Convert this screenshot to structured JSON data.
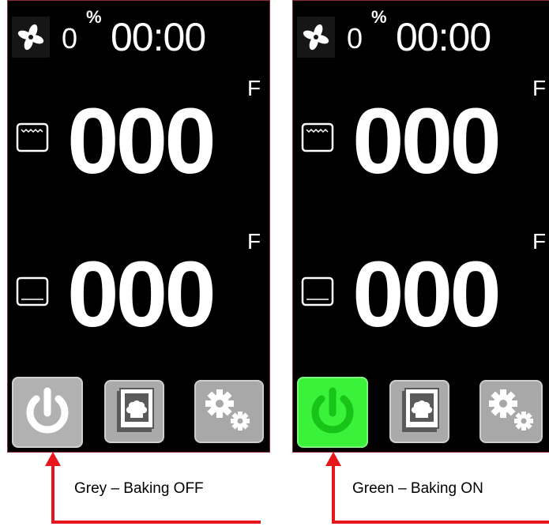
{
  "panels": [
    {
      "fan_icon": "fan-icon",
      "humidity_value": "0",
      "humidity_unit": "%",
      "clock": "00:00",
      "top_zone": {
        "icon": "oven-top-heat-icon",
        "temperature": "000",
        "unit": "F"
      },
      "bottom_zone": {
        "icon": "oven-bottom-heat-icon",
        "temperature": "000",
        "unit": "F"
      },
      "buttons": [
        {
          "name": "power",
          "icon": "power-icon",
          "state": "off",
          "color": "#b1b1b1"
        },
        {
          "name": "recipes",
          "icon": "recipe-book-icon"
        },
        {
          "name": "settings",
          "icon": "gears-icon"
        }
      ],
      "caption": "Grey – Baking OFF"
    },
    {
      "fan_icon": "fan-icon",
      "humidity_value": "0",
      "humidity_unit": "%",
      "clock": "00:00",
      "top_zone": {
        "icon": "oven-top-heat-icon",
        "temperature": "000",
        "unit": "F"
      },
      "bottom_zone": {
        "icon": "oven-bottom-heat-icon",
        "temperature": "000",
        "unit": "F"
      },
      "buttons": [
        {
          "name": "power",
          "icon": "power-icon",
          "state": "on",
          "color": "#3af23a"
        },
        {
          "name": "recipes",
          "icon": "recipe-book-icon"
        },
        {
          "name": "settings",
          "icon": "gears-icon"
        }
      ],
      "caption": "Green – Baking ON"
    }
  ],
  "colors": {
    "screen_bg": "#000000",
    "text": "#ffffff",
    "button_grey": "#b1b1b1",
    "button_green": "#3af23a",
    "arrow": "#e8161b",
    "panel_border": "#8b2a3a"
  }
}
